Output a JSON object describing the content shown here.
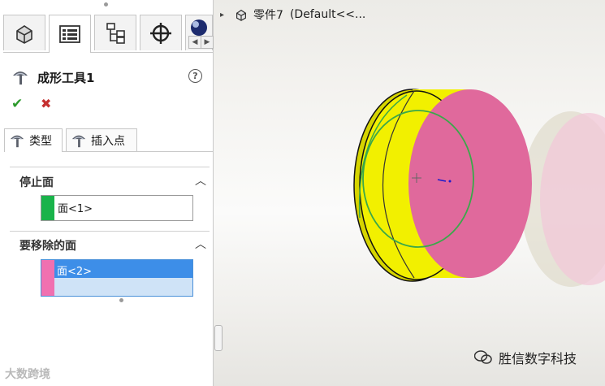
{
  "panel": {
    "title": "成形工具1",
    "help_label": "?",
    "ok_glyph": "✔",
    "cancel_glyph": "✖",
    "manager_tabs": [
      {
        "icon": "feature-manager-icon",
        "active": false
      },
      {
        "icon": "property-manager-icon",
        "active": true
      },
      {
        "icon": "configuration-manager-icon",
        "active": false
      },
      {
        "icon": "dimxpert-manager-icon",
        "active": false
      },
      {
        "icon": "display-manager-icon",
        "active": false
      }
    ],
    "scroll_left": "◀",
    "scroll_right": "▶",
    "sub_tabs": [
      {
        "label": "类型",
        "icon": "forming-tool-icon",
        "active": true
      },
      {
        "label": "插入点",
        "icon": "forming-tool-icon",
        "active": false
      }
    ],
    "stop_face": {
      "header": "停止面",
      "chevron": "︿",
      "value": "面<1>",
      "swatch_color": "#19b34a"
    },
    "remove_faces": {
      "header": "要移除的面",
      "chevron": "︿",
      "value": "面<2>",
      "swatch_color": "#f070b0",
      "selected_bg": "#3d8ee8",
      "list_bg": "#cfe3f7"
    }
  },
  "viewport": {
    "expand_arrow": "▸",
    "part_name": "零件7",
    "config_name": "(Default<<...",
    "colors": {
      "yellow_body": "#f2f000",
      "pink_face": "#e0699c",
      "green_edge": "#3aa84a",
      "ghost_pink": "#f2c8d8"
    }
  },
  "watermarks": {
    "left": "大数跨境",
    "right": "胜信数字科技"
  }
}
